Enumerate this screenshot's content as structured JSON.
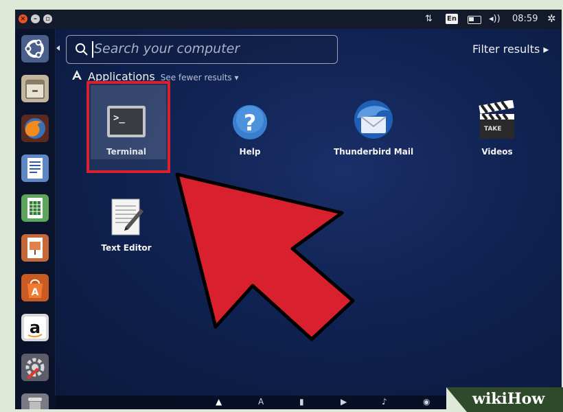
{
  "topbar": {
    "window_buttons": [
      "close",
      "minimize",
      "maximize"
    ],
    "network_icon": "updown-arrows-icon",
    "keyboard": "En",
    "battery_icon": "battery-icon",
    "volume_icon": "volume-icon",
    "time": "08:59",
    "settings_icon": "gear-icon"
  },
  "launcher": {
    "items": [
      {
        "name": "dash-home",
        "icon": "ubuntu-logo-icon"
      },
      {
        "name": "files",
        "icon": "file-cabinet-icon"
      },
      {
        "name": "firefox",
        "icon": "firefox-icon"
      },
      {
        "name": "writer",
        "icon": "document-icon"
      },
      {
        "name": "calc",
        "icon": "spreadsheet-icon"
      },
      {
        "name": "impress",
        "icon": "presentation-icon"
      },
      {
        "name": "software-center",
        "icon": "shopping-bag-icon"
      },
      {
        "name": "amazon",
        "icon": "amazon-icon"
      },
      {
        "name": "system-settings",
        "icon": "settings-tools-icon"
      },
      {
        "name": "trash",
        "icon": "trash-icon"
      }
    ]
  },
  "search": {
    "placeholder": "Search your computer"
  },
  "filter_results": "Filter results ▸",
  "section": {
    "title": "Applications",
    "toggle": "See fewer results ▾"
  },
  "apps": [
    {
      "label": "Terminal",
      "icon": "terminal-icon",
      "highlighted": true
    },
    {
      "label": "Help",
      "icon": "help-icon"
    },
    {
      "label": "Thunderbird Mail",
      "icon": "thunderbird-icon"
    },
    {
      "label": "Videos",
      "icon": "clapperboard-icon"
    },
    {
      "label": "Text Editor",
      "icon": "text-editor-icon"
    }
  ],
  "annotation": {
    "highlight_color": "#d8202f",
    "arrow_color": "#d8202f"
  },
  "watermark": "wikiHow"
}
